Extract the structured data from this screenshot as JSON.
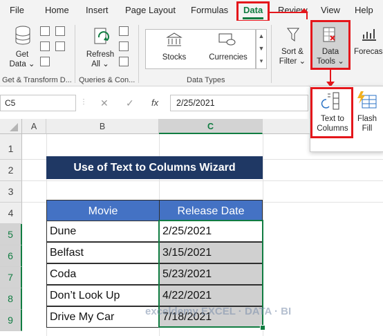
{
  "tabs": [
    "File",
    "Home",
    "Insert",
    "Page Layout",
    "Formulas",
    "Data",
    "Review",
    "View",
    "Help"
  ],
  "ribbon": {
    "get_data": [
      "Get",
      "Data ⌄"
    ],
    "refresh_all": [
      "Refresh",
      "All ⌄"
    ],
    "stocks": "Stocks",
    "currencies": "Currencies",
    "sort_filter": [
      "Sort &",
      "Filter ⌄"
    ],
    "data_tools": [
      "Data",
      "Tools ⌄"
    ],
    "forecast": "Forecas",
    "groups": {
      "get_transform": "Get & Transform D...",
      "queries": "Queries & Con...",
      "data_types": "Data Types"
    }
  },
  "flyout": {
    "text_to_columns": [
      "Text to",
      "Columns"
    ],
    "flash_fill": [
      "Flash",
      "Fill"
    ]
  },
  "formula_bar": {
    "name_box": "C5",
    "cancel": "✕",
    "enter": "✓",
    "fx": "fx",
    "value": "2/25/2021"
  },
  "sheet": {
    "columns": [
      "A",
      "B",
      "C"
    ],
    "rows": [
      "1",
      "2",
      "3",
      "4",
      "5",
      "6",
      "7",
      "8",
      "9"
    ],
    "title": "Use of Text to Columns Wizard",
    "headers": [
      "Movie",
      "Release Date"
    ],
    "data": [
      {
        "movie": "Dune",
        "date": "2/25/2021"
      },
      {
        "movie": "Belfast",
        "date": "3/15/2021"
      },
      {
        "movie": "Coda",
        "date": "5/23/2021"
      },
      {
        "movie": "Don’t Look Up",
        "date": "4/22/2021"
      },
      {
        "movie": "Drive My Car",
        "date": "7/18/2021"
      }
    ]
  },
  "watermark": "exceldemy EXCEL · DATA · BI",
  "colors": {
    "accent": "#107c41",
    "highlight": "#e4161b",
    "title_bg": "#1f3864",
    "header_bg": "#4472c4"
  }
}
